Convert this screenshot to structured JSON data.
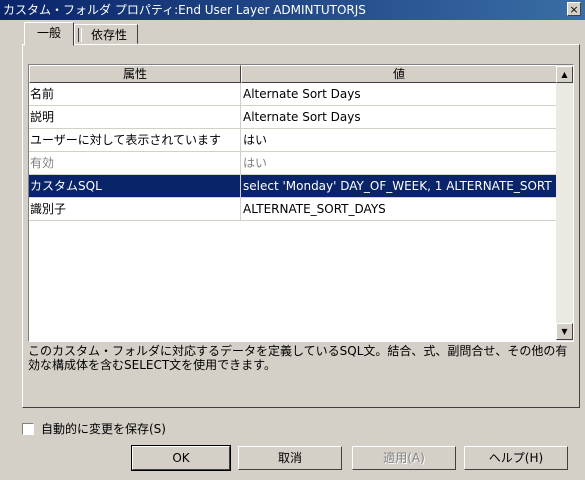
{
  "window": {
    "title": "カスタム・フォルダ プロパティ:End User Layer  ADMINTUTORJS",
    "close_glyph": "×"
  },
  "tabs": [
    {
      "label": "一般"
    },
    {
      "label": "依存性"
    }
  ],
  "grid": {
    "headers": [
      "属性",
      "値"
    ],
    "rows": [
      {
        "attr": "名前",
        "value": "Alternate Sort Days"
      },
      {
        "attr": "説明",
        "value": "Alternate Sort Days"
      },
      {
        "attr": "ユーザーに対して表示されています",
        "value": "はい"
      },
      {
        "attr": "有効",
        "value": "はい"
      },
      {
        "attr": "カスタムSQL",
        "value": "select 'Monday' DAY_OF_WEEK, 1 ALTERNATE_SORT"
      },
      {
        "attr": "識別子",
        "value": "ALTERNATE_SORT_DAYS"
      }
    ],
    "scroll_up_glyph": "▲",
    "scroll_down_glyph": "▼"
  },
  "description": "このカスタム・フォルダに対応するデータを定義しているSQL文。結合、式、副問合せ、その他の有効な構成体を含むSELECT文を使用できます。",
  "autosave": {
    "label": "自動的に変更を保存(S)",
    "checked": false
  },
  "buttons": {
    "ok": "OK",
    "cancel": "取消",
    "apply": "適用(A)",
    "help": "ヘルプ(H)"
  },
  "colors": {
    "selection": "#0a246a",
    "titlebar": "#0a246a",
    "face": "#d4d0c8"
  }
}
